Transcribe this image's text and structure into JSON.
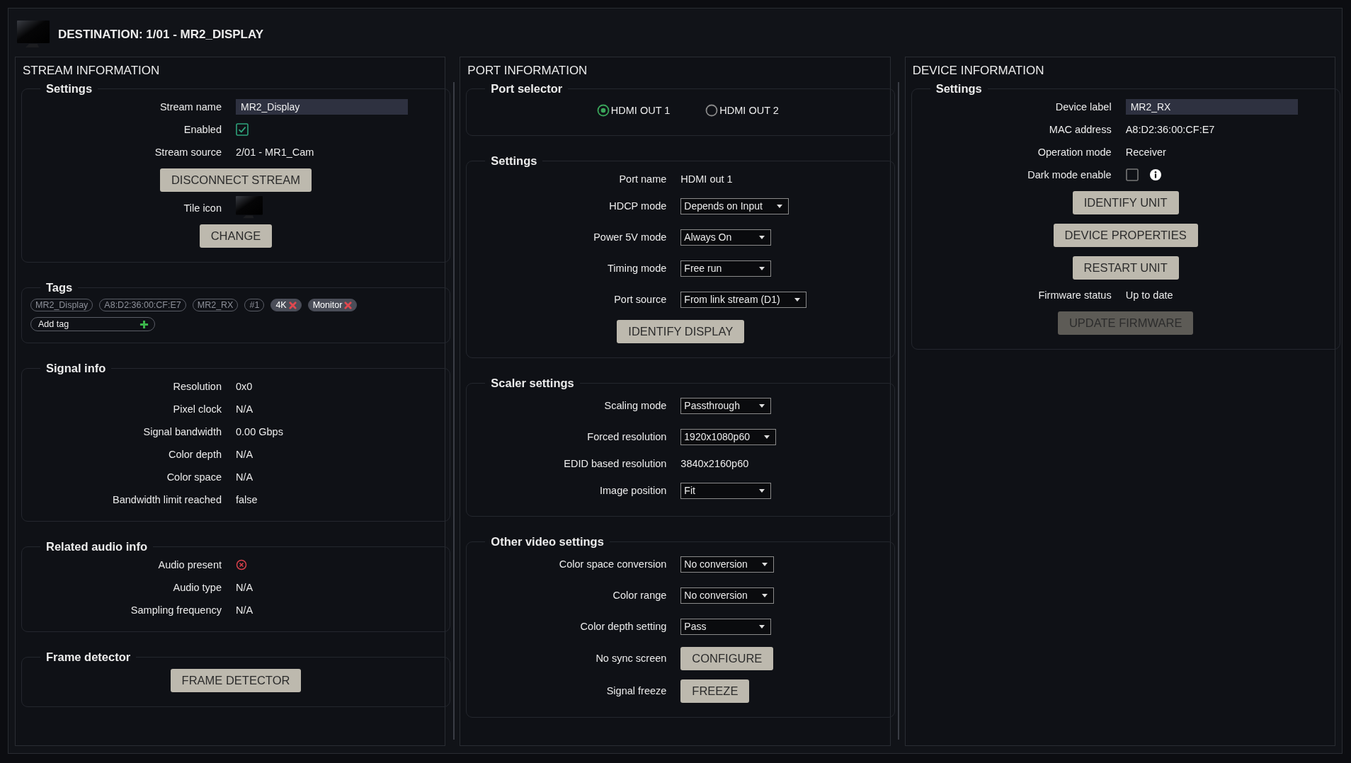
{
  "title": "DESTINATION: 1/01 - MR2_DISPLAY",
  "panels": [
    {
      "title": "STREAM INFORMATION",
      "scrollbar": true,
      "groups": [
        {
          "title": "Settings",
          "kind": "form",
          "rows": [
            {
              "kind": "input",
              "label": "Stream name",
              "value": "MR2_Display"
            },
            {
              "kind": "checkbox",
              "label": "Enabled",
              "checked": true,
              "info": false
            },
            {
              "kind": "text",
              "label": "Stream source",
              "value": "2/01 - MR1_Cam"
            },
            {
              "kind": "button",
              "button": "DISCONNECT STREAM",
              "disabled": false
            },
            {
              "kind": "icon",
              "label": "Tile icon"
            },
            {
              "kind": "button",
              "button": "CHANGE",
              "disabled": false
            }
          ]
        },
        {
          "title": "Tags",
          "kind": "tags",
          "tags": [
            {
              "label": "MR2_Display",
              "removable": false
            },
            {
              "label": "A8:D2:36:00:CF:E7",
              "removable": false
            },
            {
              "label": "MR2_RX",
              "removable": false
            },
            {
              "label": "#1",
              "removable": false
            },
            {
              "label": "4K",
              "removable": true
            },
            {
              "label": "Monitor",
              "removable": true
            }
          ],
          "add_tag": {
            "placeholder": "Add tag"
          }
        },
        {
          "title": "Signal info",
          "kind": "form",
          "rows": [
            {
              "kind": "text",
              "label": "Resolution",
              "value": "0x0"
            },
            {
              "kind": "text",
              "label": "Pixel clock",
              "value": "N/A"
            },
            {
              "kind": "text",
              "label": "Signal bandwidth",
              "value": "0.00 Gbps"
            },
            {
              "kind": "text",
              "label": "Color depth",
              "value": "N/A"
            },
            {
              "kind": "text",
              "label": "Color space",
              "value": "N/A"
            },
            {
              "kind": "text",
              "label": "Bandwidth limit reached",
              "value": "false"
            }
          ]
        },
        {
          "title": "Related audio info",
          "kind": "form",
          "rows": [
            {
              "kind": "status",
              "label": "Audio present",
              "present": false
            },
            {
              "kind": "text",
              "label": "Audio type",
              "value": "N/A"
            },
            {
              "kind": "text",
              "label": "Sampling frequency",
              "value": "N/A"
            }
          ]
        },
        {
          "title": "Frame detector",
          "kind": "form",
          "rows": [
            {
              "kind": "button",
              "button": "FRAME DETECTOR",
              "disabled": false
            }
          ]
        }
      ]
    },
    {
      "title": "PORT INFORMATION",
      "scrollbar": true,
      "groups": [
        {
          "title": "Port selector",
          "kind": "ports",
          "ports": [
            {
              "label": "HDMI OUT 1",
              "selected": true
            },
            {
              "label": "HDMI OUT 2",
              "selected": false
            }
          ]
        },
        {
          "title": "Settings",
          "kind": "form",
          "rows": [
            {
              "kind": "text",
              "label": "Port name",
              "value": "HDMI out 1"
            },
            {
              "kind": "select",
              "label": "HDCP mode",
              "value": "Depends on Input"
            },
            {
              "kind": "select",
              "label": "Power 5V mode",
              "value": "Always On"
            },
            {
              "kind": "select",
              "label": "Timing mode",
              "value": "Free run"
            },
            {
              "kind": "select",
              "label": "Port source",
              "value": "From link stream (D1)"
            },
            {
              "kind": "button",
              "button": "IDENTIFY DISPLAY",
              "disabled": false
            }
          ]
        },
        {
          "title": "Scaler settings",
          "kind": "form",
          "rows": [
            {
              "kind": "select",
              "label": "Scaling mode",
              "value": "Passthrough"
            },
            {
              "kind": "select",
              "label": "Forced resolution",
              "value": "1920x1080p60"
            },
            {
              "kind": "text",
              "label": "EDID based resolution",
              "value": "3840x2160p60"
            },
            {
              "kind": "select",
              "label": "Image position",
              "value": "Fit"
            }
          ]
        },
        {
          "title": "Other video settings",
          "kind": "form",
          "rows": [
            {
              "kind": "select",
              "label": "Color space conversion",
              "value": "No conversion"
            },
            {
              "kind": "select",
              "label": "Color range",
              "value": "No conversion"
            },
            {
              "kind": "select",
              "label": "Color depth setting",
              "value": "Pass"
            },
            {
              "kind": "button",
              "label": "No sync screen",
              "button": "CONFIGURE",
              "disabled": false
            },
            {
              "kind": "button",
              "label": "Signal freeze",
              "button": "FREEZE",
              "disabled": false
            }
          ]
        }
      ]
    },
    {
      "title": "DEVICE INFORMATION",
      "scrollbar": false,
      "groups": [
        {
          "title": "Settings",
          "kind": "form",
          "rows": [
            {
              "kind": "input",
              "label": "Device label",
              "value": "MR2_RX"
            },
            {
              "kind": "text",
              "label": "MAC address",
              "value": "A8:D2:36:00:CF:E7"
            },
            {
              "kind": "text",
              "label": "Operation mode",
              "value": "Receiver"
            },
            {
              "kind": "checkbox",
              "label": "Dark mode enable",
              "checked": false,
              "info": true
            },
            {
              "kind": "button",
              "button": "IDENTIFY UNIT",
              "disabled": false
            },
            {
              "kind": "button",
              "button": "DEVICE PROPERTIES",
              "disabled": false
            },
            {
              "kind": "button",
              "button": "RESTART UNIT",
              "disabled": false
            },
            {
              "kind": "text",
              "label": "Firmware status",
              "value": "Up to date"
            },
            {
              "kind": "button",
              "button": "UPDATE FIRMWARE",
              "disabled": true
            }
          ]
        }
      ]
    }
  ]
}
